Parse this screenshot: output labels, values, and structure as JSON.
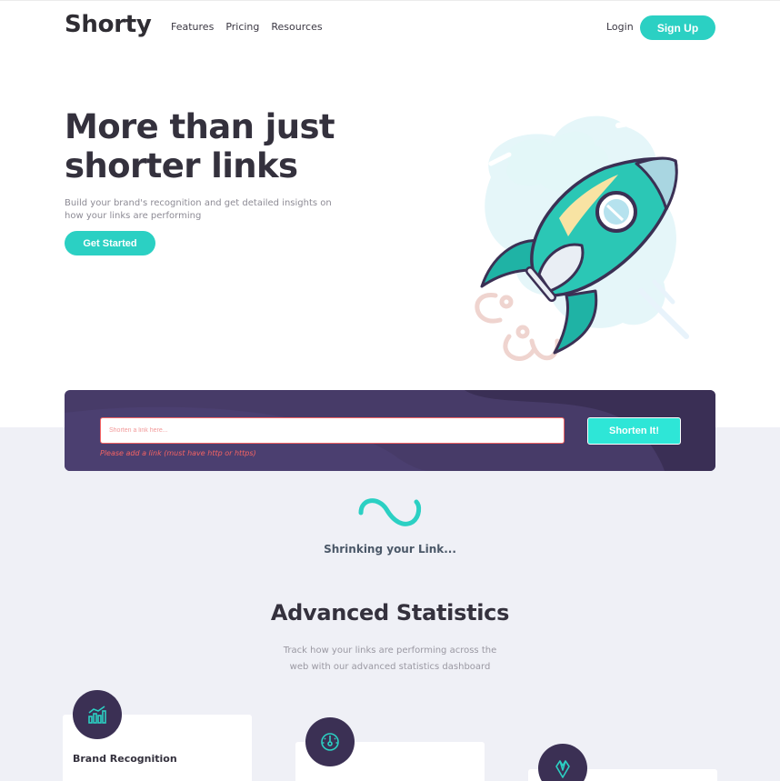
{
  "header": {
    "logo": "Shorty",
    "nav": [
      "Features",
      "Pricing",
      "Resources"
    ],
    "login": "Login",
    "signup": "Sign Up"
  },
  "hero": {
    "title": "More than just shorter links",
    "subtitle": "Build your brand's recognition and get detailed insights on how your links are performing",
    "cta": "Get Started",
    "illustration": "rocket-illustration"
  },
  "shorten": {
    "placeholder": "Shorten a link here...",
    "value": "",
    "error": "Please add a link (must have http or https)",
    "button": "Shorten It!"
  },
  "loading": {
    "text": "Shrinking your Link..."
  },
  "statistics": {
    "title": "Advanced Statistics",
    "subtitle": "Track how your links are performing across the web with our advanced statistics dashboard",
    "cards": [
      {
        "title": "Brand Recognition",
        "icon": "bar-chart-icon"
      },
      {
        "title": "",
        "icon": "speedometer-icon"
      },
      {
        "title": "",
        "icon": "paintbrush-icon"
      }
    ]
  },
  "colors": {
    "primary": "#2bd0c3",
    "dark_violet": "#3b3054",
    "panel": "#473b68",
    "error": "#f46363",
    "grey_bg": "#eff0f6"
  }
}
